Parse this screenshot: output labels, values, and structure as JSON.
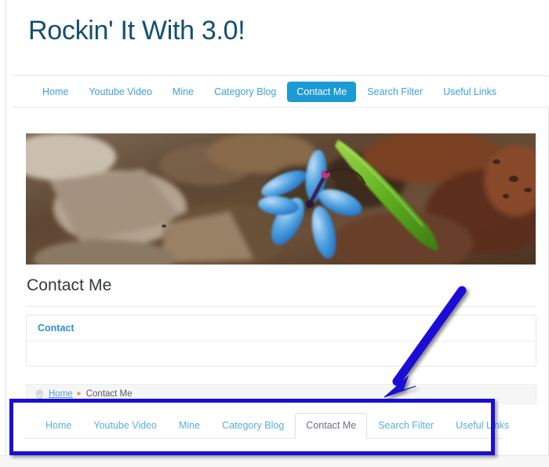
{
  "site": {
    "title": "Rockin' It With 3.0!",
    "title_color": "#13506e"
  },
  "primary_nav": {
    "items": [
      {
        "label": "Home",
        "active": false
      },
      {
        "label": "Youtube Video",
        "active": false
      },
      {
        "label": "Mine",
        "active": false
      },
      {
        "label": "Category Blog",
        "active": false
      },
      {
        "label": "Contact Me",
        "active": true
      },
      {
        "label": "Search Filter",
        "active": false
      },
      {
        "label": "Useful Links",
        "active": false
      }
    ],
    "active_bg": "#1b9ad6",
    "link_color": "#3ea0dd"
  },
  "banner": {
    "alt": "Blue scilla flower on brown forest leaf litter with a green leaf blade",
    "icon": "banner-photo"
  },
  "content": {
    "title": "Contact Me",
    "panel": {
      "header_link": "Contact",
      "header_link_color": "#2a8fd8"
    }
  },
  "breadcrumb": {
    "pin_icon": "location-pin-icon",
    "home_label": "Home",
    "separator": "▸",
    "current_label": "Contact Me"
  },
  "secondary_nav": {
    "items": [
      {
        "label": "Home",
        "active": false
      },
      {
        "label": "Youtube Video",
        "active": false
      },
      {
        "label": "Mine",
        "active": false
      },
      {
        "label": "Category Blog",
        "active": false
      },
      {
        "label": "Contact Me",
        "active": true
      },
      {
        "label": "Search Filter",
        "active": false
      },
      {
        "label": "Useful Links",
        "active": false
      }
    ],
    "link_color": "#5aaede",
    "active_color": "#6d7278"
  },
  "annotations": {
    "color": "#1a0fd6",
    "highlight_box_target": "secondary-nav",
    "arrow_target": "secondary-nav"
  }
}
